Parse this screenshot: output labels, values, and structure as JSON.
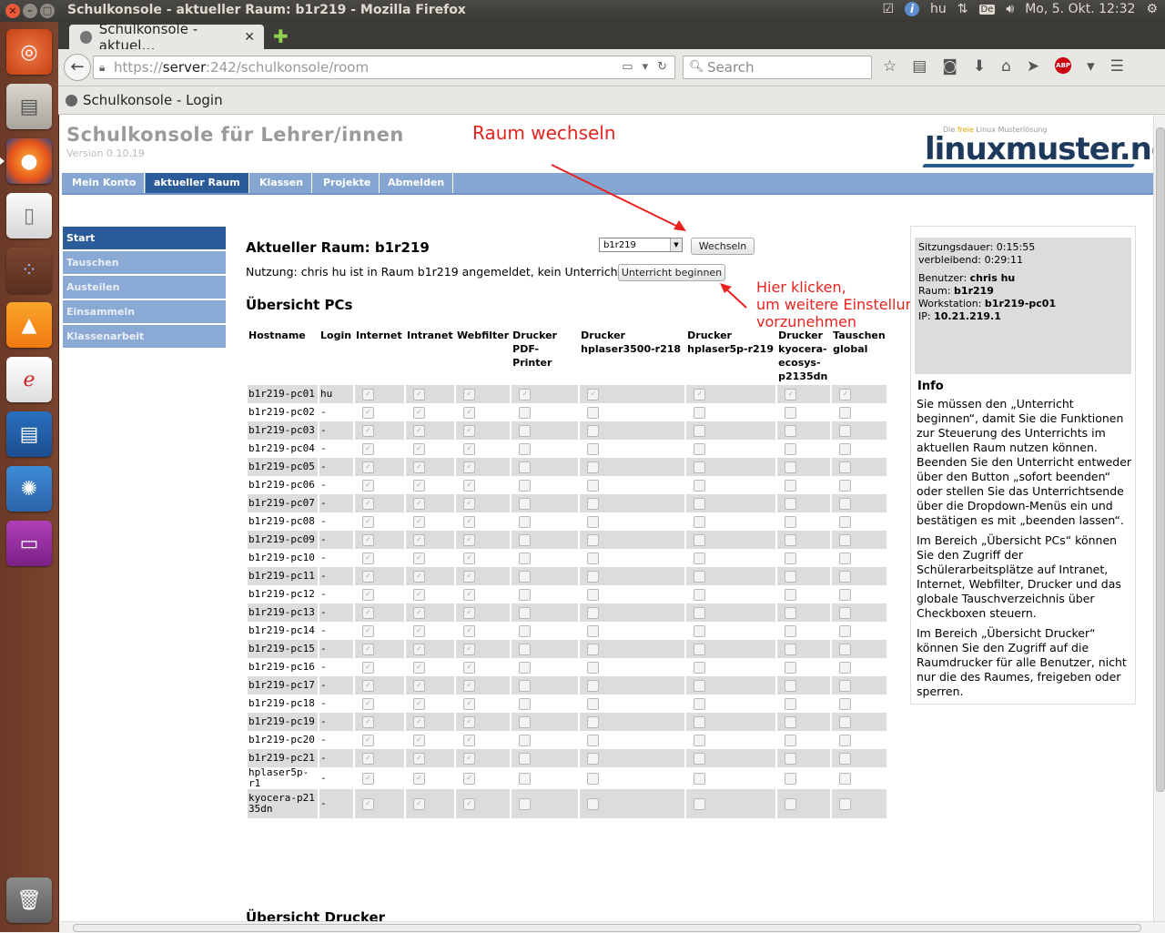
{
  "system": {
    "window_title": "Schulkonsole - aktueller Raum: b1r219 - Mozilla Firefox",
    "indicators": {
      "lang": "hu",
      "keyboard": "De",
      "clock": "Mo, 5. Okt. 12:32"
    }
  },
  "browser": {
    "tab_title": "Schulkonsole - aktuel…",
    "tab_close": "✕",
    "new_tab": "✚",
    "url_prefix": "https://",
    "url_host": "server",
    "url_rest": ":242/schulkonsole/room",
    "search_placeholder": "Search",
    "bookmark": "Schulkonsole - Login"
  },
  "page": {
    "title": "Schulkonsole für Lehrer/innen",
    "version": "Version 0.10.19",
    "logo_tag_pre": "Die",
    "logo_tag_accent": "freie",
    "logo_tag_post": "Linux Musterlösung",
    "logo_name": "linuxmuster.net",
    "mainnav": [
      "Mein Konto",
      "aktueller Raum",
      "Klassen",
      "Projekte",
      "Abmelden"
    ],
    "sidenav": [
      "Start",
      "Tauschen",
      "Austeilen",
      "Einsammeln",
      "Klassenarbeit"
    ],
    "room_heading": "Aktueller Raum: b1r219",
    "room_select": "b1r219",
    "switch_button": "Wechseln",
    "usage_text": "Nutzung: chris hu ist in Raum b1r219 angemeldet, kein Unterricht.",
    "start_button": "Unterricht beginnen",
    "pcs_heading": "Übersicht PCs",
    "printers_heading": "Übersicht Drucker",
    "annotation_switch": "Raum wechseln",
    "annotation_click": [
      "Hier klicken,",
      "um weitere Einstellungen",
      "vorzunehmen"
    ],
    "table": {
      "headers": [
        "Hostname",
        "Login",
        "Internet",
        "Intranet",
        "Webfilter",
        "Drucker PDF-Printer",
        "Drucker hplaser3500-r218",
        "Drucker hplaser5p-r219",
        "Drucker kyocera-ecosys-p2135dn",
        "Tauschen global"
      ],
      "rows": [
        {
          "host": "b1r219-pc01",
          "login": "hu"
        },
        {
          "host": "b1r219-pc02",
          "login": "-"
        },
        {
          "host": "b1r219-pc03",
          "login": "-"
        },
        {
          "host": "b1r219-pc04",
          "login": "-"
        },
        {
          "host": "b1r219-pc05",
          "login": "-"
        },
        {
          "host": "b1r219-pc06",
          "login": "-"
        },
        {
          "host": "b1r219-pc07",
          "login": "-"
        },
        {
          "host": "b1r219-pc08",
          "login": "-"
        },
        {
          "host": "b1r219-pc09",
          "login": "-"
        },
        {
          "host": "b1r219-pc10",
          "login": "-"
        },
        {
          "host": "b1r219-pc11",
          "login": "-"
        },
        {
          "host": "b1r219-pc12",
          "login": "-"
        },
        {
          "host": "b1r219-pc13",
          "login": "-"
        },
        {
          "host": "b1r219-pc14",
          "login": "-"
        },
        {
          "host": "b1r219-pc15",
          "login": "-"
        },
        {
          "host": "b1r219-pc16",
          "login": "-"
        },
        {
          "host": "b1r219-pc17",
          "login": "-"
        },
        {
          "host": "b1r219-pc18",
          "login": "-"
        },
        {
          "host": "b1r219-pc19",
          "login": "-"
        },
        {
          "host": "b1r219-pc20",
          "login": "-"
        },
        {
          "host": "b1r219-pc21",
          "login": "-"
        },
        {
          "host": "hplaser5p-r1",
          "login": "-"
        },
        {
          "host": "kyocera-p2135dn",
          "login": "-"
        }
      ]
    },
    "session": {
      "duration_label": "Sitzungsdauer:",
      "duration": "0:15:55",
      "remaining_label": "verbleibend:",
      "remaining": "0:29:11",
      "user_label": "Benutzer:",
      "user": "chris hu",
      "room_label": "Raum:",
      "room": "b1r219",
      "workstation_label": "Workstation:",
      "workstation": "b1r219-pc01",
      "ip_label": "IP:",
      "ip": "10.21.219.1"
    },
    "info": {
      "heading": "Info",
      "p1": "Sie müssen den „Unterricht beginnen“, damit Sie die Funktionen zur Steuerung des Unterrichts im aktuellen Raum nutzen können. Beenden Sie den Unterricht entweder über den Button „sofort beenden“ oder stellen Sie das Unterrichtsende über die Dropdown-Menüs ein und bestätigen es mit „beenden lassen“.",
      "p2": "Im Bereich „Übersicht PCs“ können Sie den Zugriff der Schülerarbeitsplätze auf Intranet, Internet, Webfilter, Drucker und das globale Tauschverzeichnis über Checkboxen steuern.",
      "p3": "Im Bereich „Übersicht Drucker“ können Sie den Zugriff auf die Raumdrucker für alle Benutzer, nicht nur die des Raumes, freigeben oder sperren."
    }
  }
}
